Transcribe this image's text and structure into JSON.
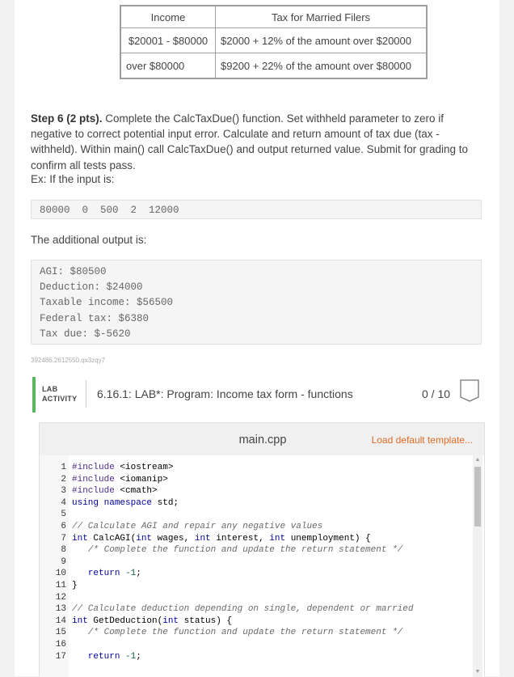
{
  "tax_table": {
    "headers": [
      "Income",
      "Tax for Married Filers"
    ],
    "rows": [
      [
        "$20001 - $80000",
        "$2000 + 12% of the amount over $20000"
      ],
      [
        "over $80000",
        "$9200 + 22% of the amount over $80000"
      ]
    ]
  },
  "step": {
    "heading": "Step 6 (2 pts).",
    "text": " Complete the CalcTaxDue() function. Set withheld parameter to zero if negative to correct potential input error. Calculate and return amount of tax due (tax - withheld). Within main() call CalcTaxDue() and output returned value. Submit for grading to confirm all tests pass."
  },
  "example_label": "Ex: If the input is:",
  "example_input": "80000  0  500  2  12000",
  "additional_label": "The additional output is:",
  "additional_output": [
    "AGI: $80500",
    "Deduction: $24000",
    "Taxable income: $56500",
    "Federal tax: $6380",
    "Tax due: $-5620"
  ],
  "activity_tag": "392486.2612550.qx3zqy7",
  "lab": {
    "label_line1": "LAB",
    "label_line2": "ACTIVITY",
    "title": "6.16.1: LAB*: Program: Income tax form - functions",
    "score": "0 / 10"
  },
  "editor": {
    "filename": "main.cpp",
    "load_template": "Load default template...",
    "lines": [
      "#include <iostream>",
      "#include <iomanip>",
      "#include <cmath>",
      "using namespace std;",
      "",
      "// Calculate AGI and repair any negative values",
      "int CalcAGI(int wages, int interest, int unemployment) {",
      "   /* Complete the function and update the return statement */",
      "",
      "   return -1;",
      "}",
      "",
      "// Calculate deduction depending on single, dependent or married",
      "int GetDeduction(int status) {",
      "   /* Complete the function and update the return statement */",
      "",
      "   return -1;"
    ]
  },
  "colors": {
    "lab_accent": "#5bb75b",
    "link": "#e06c24"
  }
}
